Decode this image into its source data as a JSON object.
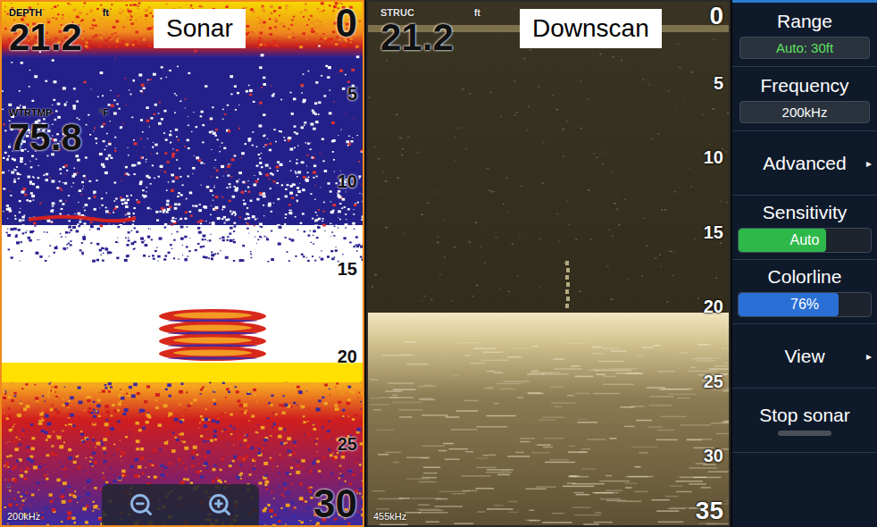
{
  "panels": [
    {
      "kind": "sonar",
      "title": "Sonar",
      "selected": true,
      "readouts": [
        {
          "label": "DEPTH",
          "unit": "ft",
          "value": "21.2"
        },
        {
          "label": "WTRTMP",
          "unit": "°F",
          "value": "75.8"
        }
      ],
      "scale": [
        "0",
        "5",
        "10",
        "15",
        "20",
        "25",
        "30"
      ],
      "frequency": "200kHz",
      "zoom_controls": true
    },
    {
      "kind": "downscan",
      "title": "Downscan",
      "selected": false,
      "readouts": [
        {
          "label": "STRUC",
          "unit": "ft",
          "value": "21.2"
        }
      ],
      "scale": [
        "0",
        "5",
        "10",
        "15",
        "20",
        "25",
        "30",
        "35"
      ],
      "frequency": "455kHz",
      "zoom_controls": false
    }
  ],
  "menu": {
    "items": [
      {
        "kind": "value",
        "label": "Range",
        "value": "Auto: 30ft",
        "color": "#5fe35f"
      },
      {
        "kind": "value",
        "label": "Frequency",
        "value": "200kHz",
        "color": "#ffffff"
      },
      {
        "kind": "submenu",
        "label": "Advanced",
        "arrow": "▸"
      },
      {
        "kind": "slider",
        "label": "Sensitivity",
        "value": "Auto",
        "level": 0.66,
        "color": "#2fb84a"
      },
      {
        "kind": "slider",
        "label": "Colorline",
        "value": "76%",
        "level": 0.76,
        "color": "#2a6fd6"
      },
      {
        "kind": "submenu",
        "label": "View",
        "arrow": "▸"
      },
      {
        "kind": "button",
        "label": "Stop sonar"
      }
    ]
  }
}
